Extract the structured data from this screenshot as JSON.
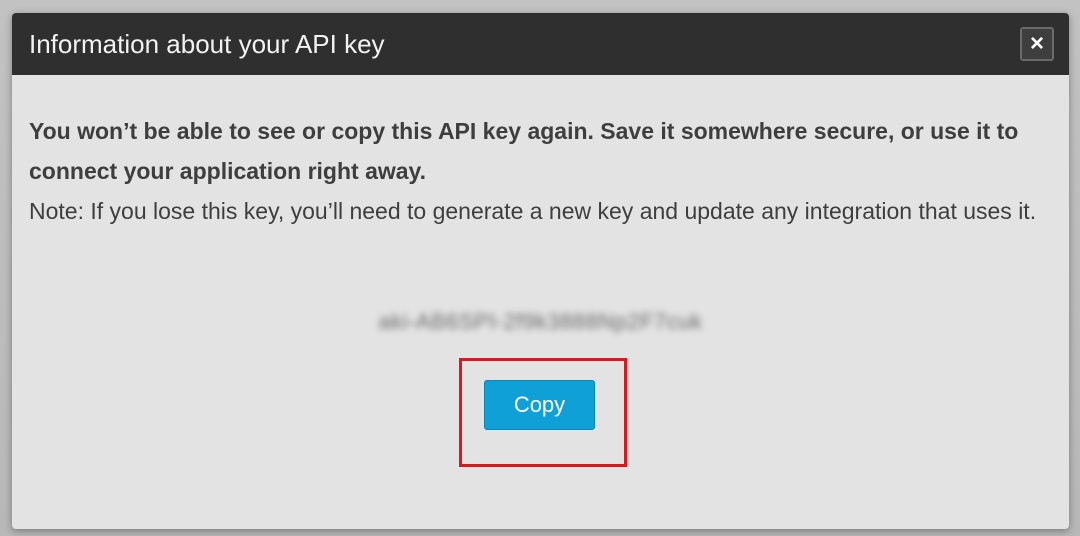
{
  "dialog": {
    "title": "Information about your API key",
    "close_label": "×",
    "warning_text": "You won’t be able to see or copy this API key again. Save it somewhere secure, or use it to connect your application right away.",
    "note_text": "Note: If you lose this key, you’ll need to generate a new key and update any integration that uses it.",
    "api_key_masked": "aki-AB6SPI-2f9k3888Np2F7cuk",
    "copy_button_label": "Copy"
  },
  "colors": {
    "header_bg": "#2f2f2f",
    "body_bg": "#e3e3e3",
    "copy_button": "#0fa0d8",
    "highlight_border": "#e0161e"
  },
  "icons": {
    "close": "close-icon"
  }
}
